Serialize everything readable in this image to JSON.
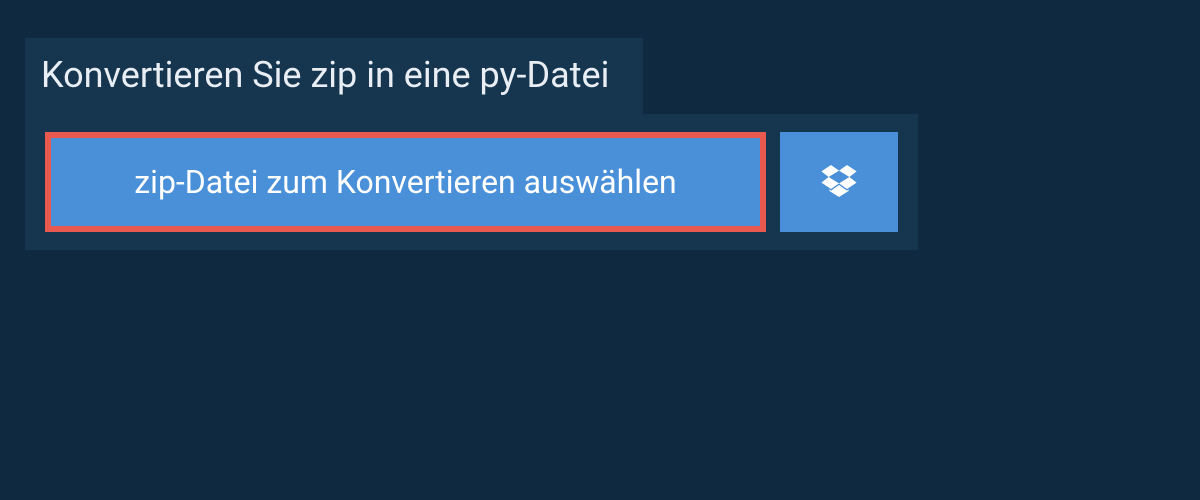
{
  "header": {
    "title": "Konvertieren Sie zip in eine py-Datei"
  },
  "upload": {
    "select_button_label": "zip-Datei zum Konvertieren auswählen"
  },
  "colors": {
    "background": "#0f2940",
    "panel": "#16354f",
    "button": "#4a90d9",
    "highlight_border": "#e85a4f",
    "text_light": "#ffffff"
  }
}
